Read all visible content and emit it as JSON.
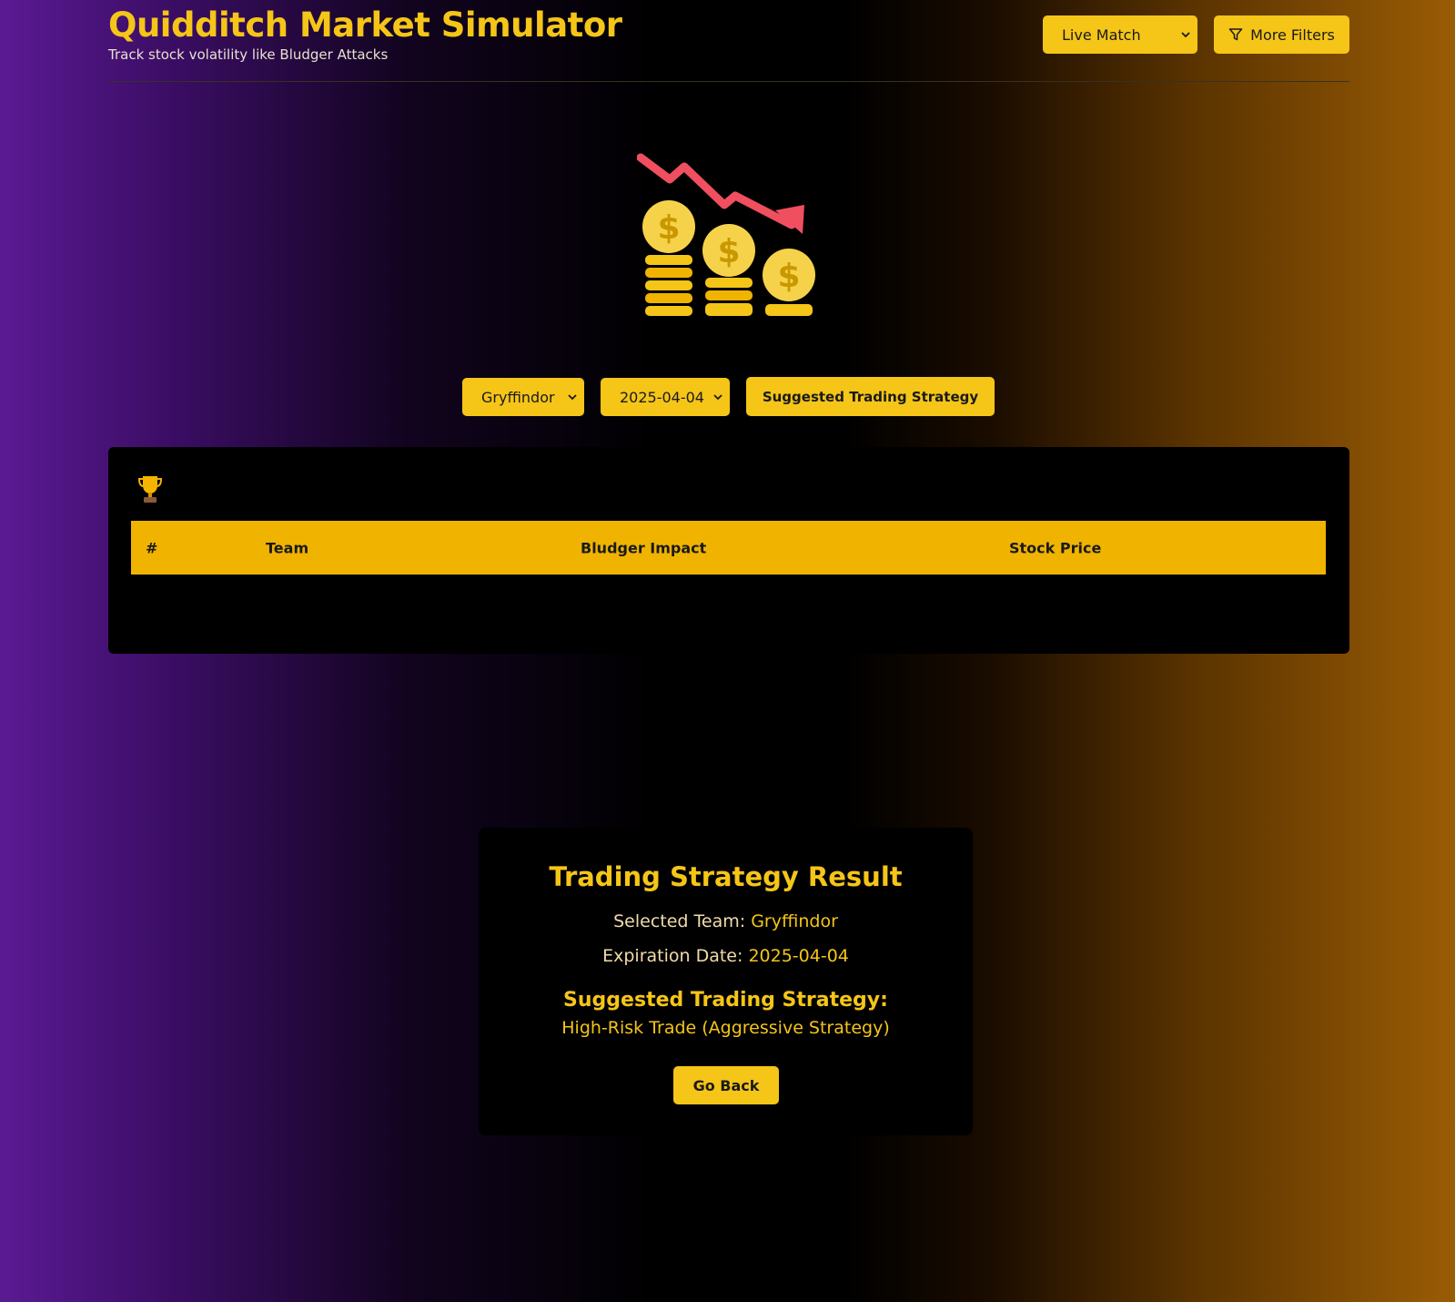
{
  "app": {
    "title": "Quidditch Market Simulator",
    "subtitle": "Track stock volatility like Bludger Attacks"
  },
  "header": {
    "mode_select": {
      "value": "Live Match"
    },
    "filters_button": {
      "label": "More Filters",
      "icon": "filter-icon"
    }
  },
  "hero": {
    "icon": "falling-coins-chart-icon"
  },
  "controls": {
    "team_select": {
      "value": "Gryffindor"
    },
    "date_select": {
      "value": "2025-04-04"
    },
    "strategy_button": {
      "label": "Suggested Trading Strategy"
    }
  },
  "table": {
    "icon": "trophy-icon",
    "columns": [
      "#",
      "Team",
      "Bludger Impact",
      "Stock Price"
    ],
    "rows": []
  },
  "result": {
    "title": "Trading Strategy Result",
    "team_label": "Selected Team:",
    "team_value": "Gryffindor",
    "date_label": "Expiration Date:",
    "date_value": "2025-04-04",
    "strategy_label": "Suggested Trading Strategy:",
    "strategy_value": "High-Risk Trade (Aggressive Strategy)",
    "back_button": "Go Back"
  },
  "colors": {
    "accent": "#f5c518",
    "header_row": "#f0b400",
    "panel": "#000000",
    "gradient_left": "#5b1a94",
    "gradient_right": "#9a5c05",
    "arrow": "#ef4f5f"
  }
}
